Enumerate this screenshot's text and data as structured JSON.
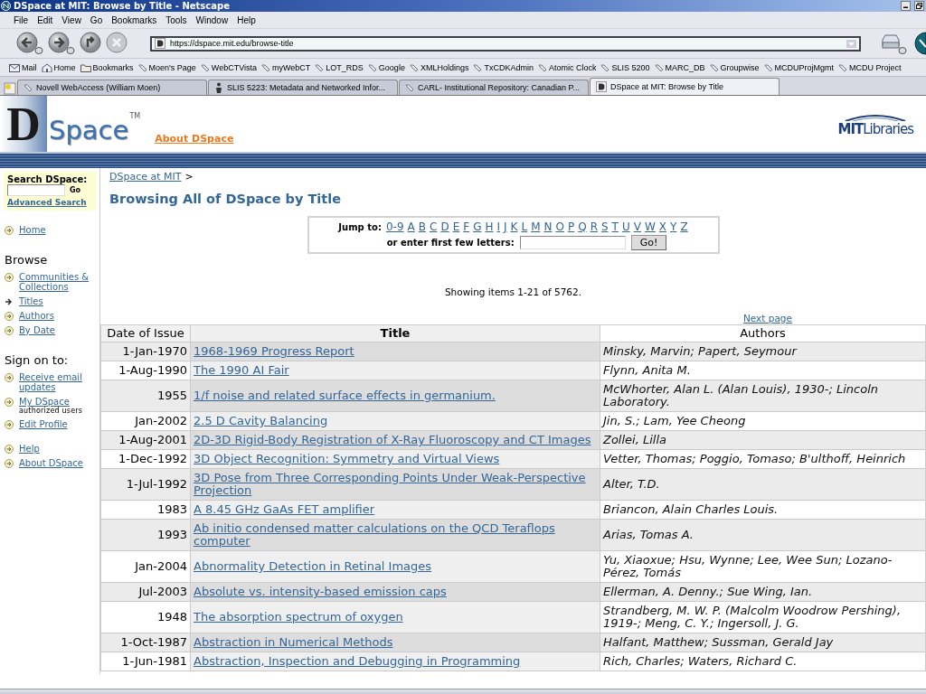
{
  "window": {
    "title": "DSpace at MIT: Browse by Title - Netscape"
  },
  "menu": [
    "File",
    "Edit",
    "View",
    "Go",
    "Bookmarks",
    "Tools",
    "Window",
    "Help"
  ],
  "address": {
    "url": "https://dspace.mit.edu/browse-title"
  },
  "bookmarks": [
    {
      "label": "Mail",
      "kind": "mail"
    },
    {
      "label": "Home",
      "kind": "home"
    },
    {
      "label": "Bookmarks",
      "kind": "folder"
    },
    {
      "label": "Moen's Page",
      "kind": "link"
    },
    {
      "label": "WebCTVista",
      "kind": "link"
    },
    {
      "label": "myWebCT",
      "kind": "link"
    },
    {
      "label": "LOT_RDS",
      "kind": "link"
    },
    {
      "label": "Google",
      "kind": "link"
    },
    {
      "label": "XMLHoldings",
      "kind": "link"
    },
    {
      "label": "TxCDKAdmin",
      "kind": "link"
    },
    {
      "label": "Atomic Clock",
      "kind": "link"
    },
    {
      "label": "SLIS 5200",
      "kind": "link"
    },
    {
      "label": "MARC_DB",
      "kind": "link"
    },
    {
      "label": "Groupwise",
      "kind": "link"
    },
    {
      "label": "MCDUProjMgmt",
      "kind": "link"
    },
    {
      "label": "MCDU Project",
      "kind": "link"
    }
  ],
  "tabs": [
    {
      "label": "Novell WebAccess (William Moen)",
      "kind": "link",
      "selected": false
    },
    {
      "label": "SLIS 5223: Metadata and Networked Infor...",
      "kind": "figure",
      "selected": false
    },
    {
      "label": "CARL- Institutional Repository: Canadian P...",
      "kind": "link",
      "selected": false
    },
    {
      "label": "DSpace at MIT: Browse by Title",
      "kind": "site",
      "selected": true
    }
  ],
  "header": {
    "logo_letter": "D",
    "logo_word": "Space",
    "logo_mark": "TM",
    "about_link": "About DSpace",
    "partner_logo": "**MIT**Libraries"
  },
  "sidebar": {
    "search": {
      "label": "Search DSpace:",
      "button": "Go",
      "advanced": "Advanced Search"
    },
    "sections": [
      {
        "items": [
          {
            "label": "Home",
            "selected": false
          }
        ]
      },
      {
        "heading": "Browse",
        "items": [
          {
            "label": "Communities & Collections",
            "selected": false
          },
          {
            "label": "Titles",
            "selected": true
          },
          {
            "label": "Authors",
            "selected": false
          },
          {
            "label": "By Date",
            "selected": false
          }
        ]
      },
      {
        "heading": "Sign on to:",
        "items": [
          {
            "label": "Receive email updates",
            "selected": false
          },
          {
            "label": "My DSpace",
            "note": "authorized users",
            "selected": false
          },
          {
            "label": "Edit Profile",
            "selected": false
          }
        ]
      },
      {
        "items": [
          {
            "label": "Help",
            "selected": false
          },
          {
            "label": "About DSpace",
            "selected": false
          }
        ]
      }
    ]
  },
  "breadcrumb": {
    "link": "DSpace at MIT",
    "separator": ">"
  },
  "heading": "Browsing All of DSpace by Title",
  "jump": {
    "label": "Jump to:",
    "letters": [
      "0-9",
      "A",
      "B",
      "C",
      "D",
      "E",
      "F",
      "G",
      "H",
      "I",
      "J",
      "K",
      "L",
      "M",
      "N",
      "O",
      "P",
      "Q",
      "R",
      "S",
      "T",
      "U",
      "V",
      "W",
      "X",
      "Y",
      "Z"
    ],
    "prompt": "or enter first few letters:",
    "button": "Go!"
  },
  "summary": "Showing items 1-21 of 5762.",
  "next_page": "Next page",
  "table": {
    "columns": [
      "Date of Issue",
      "Title",
      "Authors"
    ],
    "rows": [
      {
        "date": "1-Jan-1970",
        "title": "1968-1969 Progress Report",
        "authors": "Minsky, Marvin; Papert, Seymour"
      },
      {
        "date": "1-Aug-1990",
        "title": "The 1990 AI Fair",
        "authors": "Flynn, Anita M."
      },
      {
        "date": "1955",
        "title": "1/f noise and related surface effects in germanium.",
        "authors": "McWhorter, Alan L. (Alan Louis), 1930-; Lincoln Laboratory."
      },
      {
        "date": "Jan-2002",
        "title": "2.5 D Cavity Balancing",
        "authors": "Jin, S.; Lam, Yee Cheong"
      },
      {
        "date": "1-Aug-2001",
        "title": "2D-3D Rigid-Body Registration of X-Ray Fluoroscopy and CT Images",
        "authors": "Zollei, Lilla"
      },
      {
        "date": "1-Dec-1992",
        "title": "3D Object Recognition: Symmetry and Virtual Views",
        "authors": "Vetter, Thomas; Poggio, Tomaso; B'ulthoff, Heinrich"
      },
      {
        "date": "1-Jul-1992",
        "title": "3D Pose from Three Corresponding Points Under Weak-Perspective Projection",
        "authors": "Alter, T.D."
      },
      {
        "date": "1983",
        "title": "A 8.45 GHz GaAs FET amplifier",
        "authors": "Briancon, Alain Charles Louis."
      },
      {
        "date": "1993",
        "title": "Ab initio condensed matter calculations on the QCD Teraflops computer",
        "authors": "Arias, Tomas A."
      },
      {
        "date": "Jan-2004",
        "title": "Abnormality Detection in Retinal Images",
        "authors": "Yu, Xiaoxue; Hsu, Wynne; Lee, Wee Sun; Lozano-Pérez, Tomás"
      },
      {
        "date": "Jul-2003",
        "title": "Absolute vs. intensity-based emission caps",
        "authors": "Ellerman, A. Denny.; Sue Wing, Ian."
      },
      {
        "date": "1948",
        "title": "The absorption spectrum of oxygen",
        "authors": "Strandberg, M. W. P. (Malcolm Woodrow Pershing), 1919-; Meng, C. Y.; Ingersoll, J. G."
      },
      {
        "date": "1-Oct-1987",
        "title": "Abstraction in Numerical Methods",
        "authors": "Halfant, Matthew; Sussman, Gerald Jay"
      },
      {
        "date": "1-Jun-1981",
        "title": "Abstraction, Inspection and Debugging in Programming",
        "authors": "Rich, Charles; Waters, Richard C."
      }
    ]
  }
}
